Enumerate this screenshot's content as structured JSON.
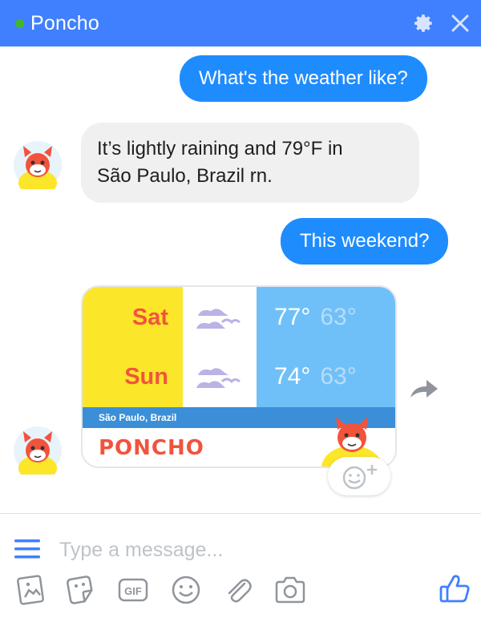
{
  "header": {
    "title": "Poncho",
    "online_color": "#42b72a",
    "bg_color": "#4080ff"
  },
  "messages": [
    {
      "from": "user",
      "text": "What's the weather like?"
    },
    {
      "from": "bot",
      "line1": "It’s lightly raining and 79°F in",
      "line2": "São Paulo, Brazil rn."
    },
    {
      "from": "user",
      "text": "This weekend?"
    }
  ],
  "forecast": {
    "days": [
      {
        "day": "Sat",
        "icon": "cloud-icon",
        "high": "77°",
        "low": "63°"
      },
      {
        "day": "Sun",
        "icon": "cloud-icon",
        "high": "74°",
        "low": "63°"
      }
    ],
    "location": "São Paulo, Brazil",
    "brand": "PONCHO"
  },
  "composer": {
    "placeholder": "Type a message...",
    "tools": [
      "image-icon",
      "sticker-icon",
      "gif-icon",
      "emoji-icon",
      "attachment-icon",
      "camera-icon"
    ],
    "gif_label": "GIF",
    "like_icon": "thumbs-up-icon"
  },
  "colors": {
    "accent": "#1f8cfe",
    "card_yellow": "#fce62a",
    "card_blue": "#6fc0f8",
    "brand_red": "#f2533d"
  }
}
